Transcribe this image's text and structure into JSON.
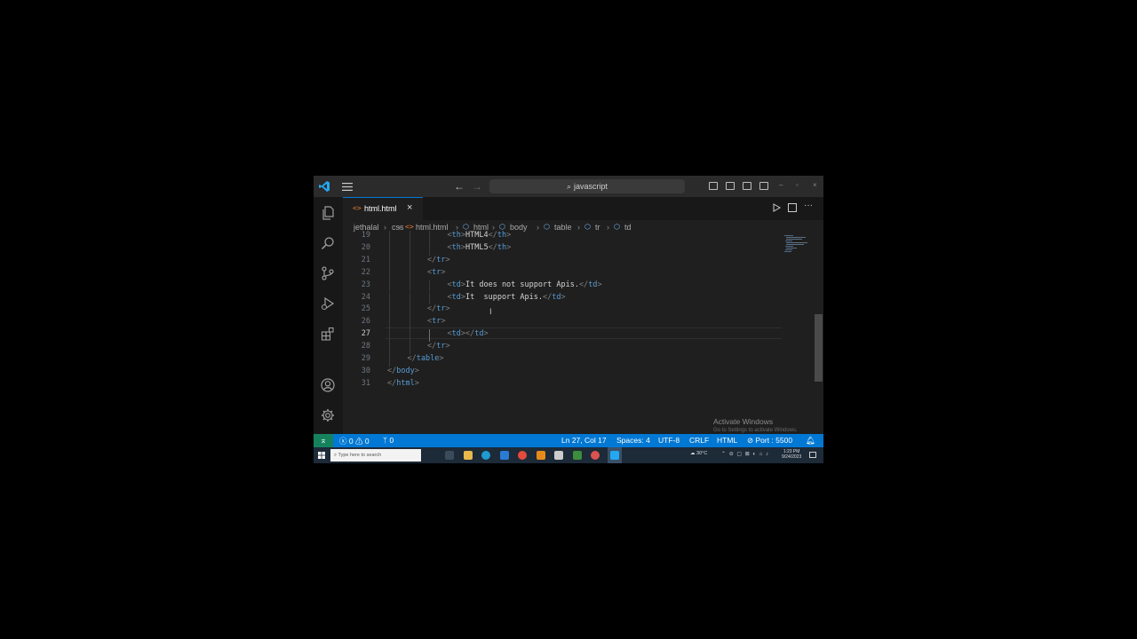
{
  "titlebar": {
    "search_text": "javascript"
  },
  "tabs": [
    {
      "label": "html.html",
      "icon": "html-file-icon"
    }
  ],
  "breadcrumb": [
    "jethalal",
    "css",
    "html.html",
    "html",
    "body",
    "table",
    "tr",
    "td"
  ],
  "editor": {
    "lines": [
      {
        "num": "19",
        "indent": 3,
        "parts": [
          [
            "g",
            "<"
          ],
          [
            "t",
            "th"
          ],
          [
            "g",
            ">"
          ],
          [
            "x",
            "HTML4"
          ],
          [
            "g",
            "</"
          ],
          [
            "t",
            "th"
          ],
          [
            "g",
            ">"
          ]
        ]
      },
      {
        "num": "20",
        "indent": 3,
        "parts": [
          [
            "g",
            "<"
          ],
          [
            "t",
            "th"
          ],
          [
            "g",
            ">"
          ],
          [
            "x",
            "HTML5"
          ],
          [
            "g",
            "</"
          ],
          [
            "t",
            "th"
          ],
          [
            "g",
            ">"
          ]
        ]
      },
      {
        "num": "21",
        "indent": 2,
        "parts": [
          [
            "g",
            "</"
          ],
          [
            "t",
            "tr"
          ],
          [
            "g",
            ">"
          ]
        ]
      },
      {
        "num": "22",
        "indent": 2,
        "parts": [
          [
            "g",
            "<"
          ],
          [
            "t",
            "tr"
          ],
          [
            "g",
            ">"
          ]
        ]
      },
      {
        "num": "23",
        "indent": 3,
        "parts": [
          [
            "g",
            "<"
          ],
          [
            "t",
            "td"
          ],
          [
            "g",
            ">"
          ],
          [
            "x",
            "It does not support Apis."
          ],
          [
            "g",
            "</"
          ],
          [
            "t",
            "td"
          ],
          [
            "g",
            ">"
          ]
        ]
      },
      {
        "num": "24",
        "indent": 3,
        "parts": [
          [
            "g",
            "<"
          ],
          [
            "t",
            "td"
          ],
          [
            "g",
            ">"
          ],
          [
            "x",
            "It  support Apis."
          ],
          [
            "g",
            "</"
          ],
          [
            "t",
            "td"
          ],
          [
            "g",
            ">"
          ]
        ]
      },
      {
        "num": "25",
        "indent": 2,
        "parts": [
          [
            "g",
            "</"
          ],
          [
            "t",
            "tr"
          ],
          [
            "g",
            ">"
          ]
        ]
      },
      {
        "num": "26",
        "indent": 2,
        "parts": [
          [
            "g",
            "<"
          ],
          [
            "t",
            "tr"
          ],
          [
            "g",
            ">"
          ]
        ]
      },
      {
        "num": "27",
        "indent": 3,
        "parts": [
          [
            "g",
            "<"
          ],
          [
            "t",
            "td"
          ],
          [
            "g",
            "></"
          ],
          [
            "t",
            "td"
          ],
          [
            "g",
            ">"
          ]
        ]
      },
      {
        "num": "28",
        "indent": 2,
        "parts": [
          [
            "g",
            "</"
          ],
          [
            "t",
            "tr"
          ],
          [
            "g",
            ">"
          ]
        ]
      },
      {
        "num": "29",
        "indent": 1,
        "parts": [
          [
            "g",
            "</"
          ],
          [
            "t",
            "table"
          ],
          [
            "g",
            ">"
          ]
        ]
      },
      {
        "num": "30",
        "indent": 0,
        "parts": [
          [
            "g",
            "</"
          ],
          [
            "t",
            "body"
          ],
          [
            "g",
            ">"
          ]
        ]
      },
      {
        "num": "31",
        "indent": 0,
        "parts": [
          [
            "g",
            "</"
          ],
          [
            "t",
            "html"
          ],
          [
            "g",
            ">"
          ]
        ]
      }
    ],
    "current_line": "27"
  },
  "watermark": {
    "title": "Activate Windows",
    "subtitle": "Go to Settings to activate Windows."
  },
  "statusbar": {
    "errors": "0",
    "warnings": "0",
    "ports": "0",
    "position": "Ln 27, Col 17",
    "spaces": "Spaces: 4",
    "encoding": "UTF-8",
    "eol": "CRLF",
    "language": "HTML",
    "port": "Port : 5500"
  },
  "taskbar": {
    "search_placeholder": "Type here to search",
    "weather": "30°C",
    "time": "1:23 PM",
    "date": "9/24/2023"
  },
  "colors": {
    "accent": "#0078d4",
    "editor_bg": "#1f1f1f",
    "tag": "#569cd6",
    "bracket": "#808080"
  }
}
